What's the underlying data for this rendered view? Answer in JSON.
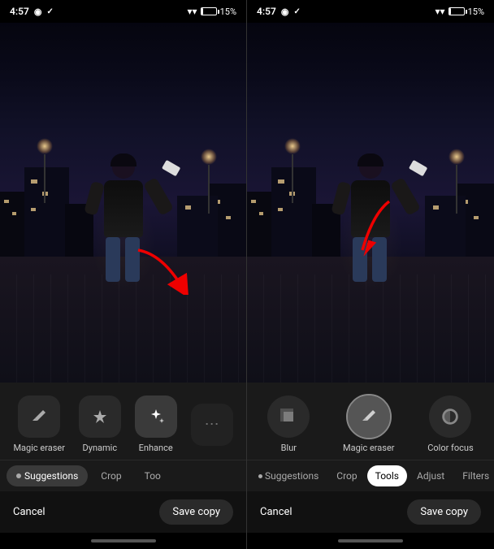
{
  "left_panel": {
    "status": {
      "time": "4:57",
      "battery": "15%"
    },
    "tabs": [
      {
        "id": "suggestions",
        "label": "Suggestions",
        "active": true,
        "has_dot": true
      },
      {
        "id": "crop",
        "label": "Crop",
        "active": false
      },
      {
        "id": "tools_partial",
        "label": "Too",
        "active": false
      }
    ],
    "tools": [
      {
        "id": "magic_eraser",
        "label": "Magic eraser",
        "icon": "✦"
      },
      {
        "id": "dynamic",
        "label": "Dynamic",
        "icon": "△"
      },
      {
        "id": "enhance",
        "label": "Enhance",
        "icon": "✧"
      }
    ],
    "actions": {
      "cancel": "Cancel",
      "save": "Save copy"
    }
  },
  "right_panel": {
    "status": {
      "time": "4:57",
      "battery": "15%"
    },
    "tabs": [
      {
        "id": "suggestions",
        "label": "Suggestions",
        "active": false,
        "has_dot": true
      },
      {
        "id": "crop",
        "label": "Crop",
        "active": false
      },
      {
        "id": "tools",
        "label": "Tools",
        "active": true
      },
      {
        "id": "adjust",
        "label": "Adjust",
        "active": false
      },
      {
        "id": "filters",
        "label": "Filters",
        "active": false
      }
    ],
    "tools": [
      {
        "id": "blur",
        "label": "Blur",
        "icon": "⊞"
      },
      {
        "id": "magic_eraser",
        "label": "Magic eraser",
        "icon": "✦",
        "selected": true
      },
      {
        "id": "color_focus",
        "label": "Color focus",
        "icon": "◑"
      }
    ],
    "actions": {
      "cancel": "Cancel",
      "save": "Save copy"
    }
  },
  "icons": {
    "wifi": "▲",
    "battery": "▮"
  }
}
